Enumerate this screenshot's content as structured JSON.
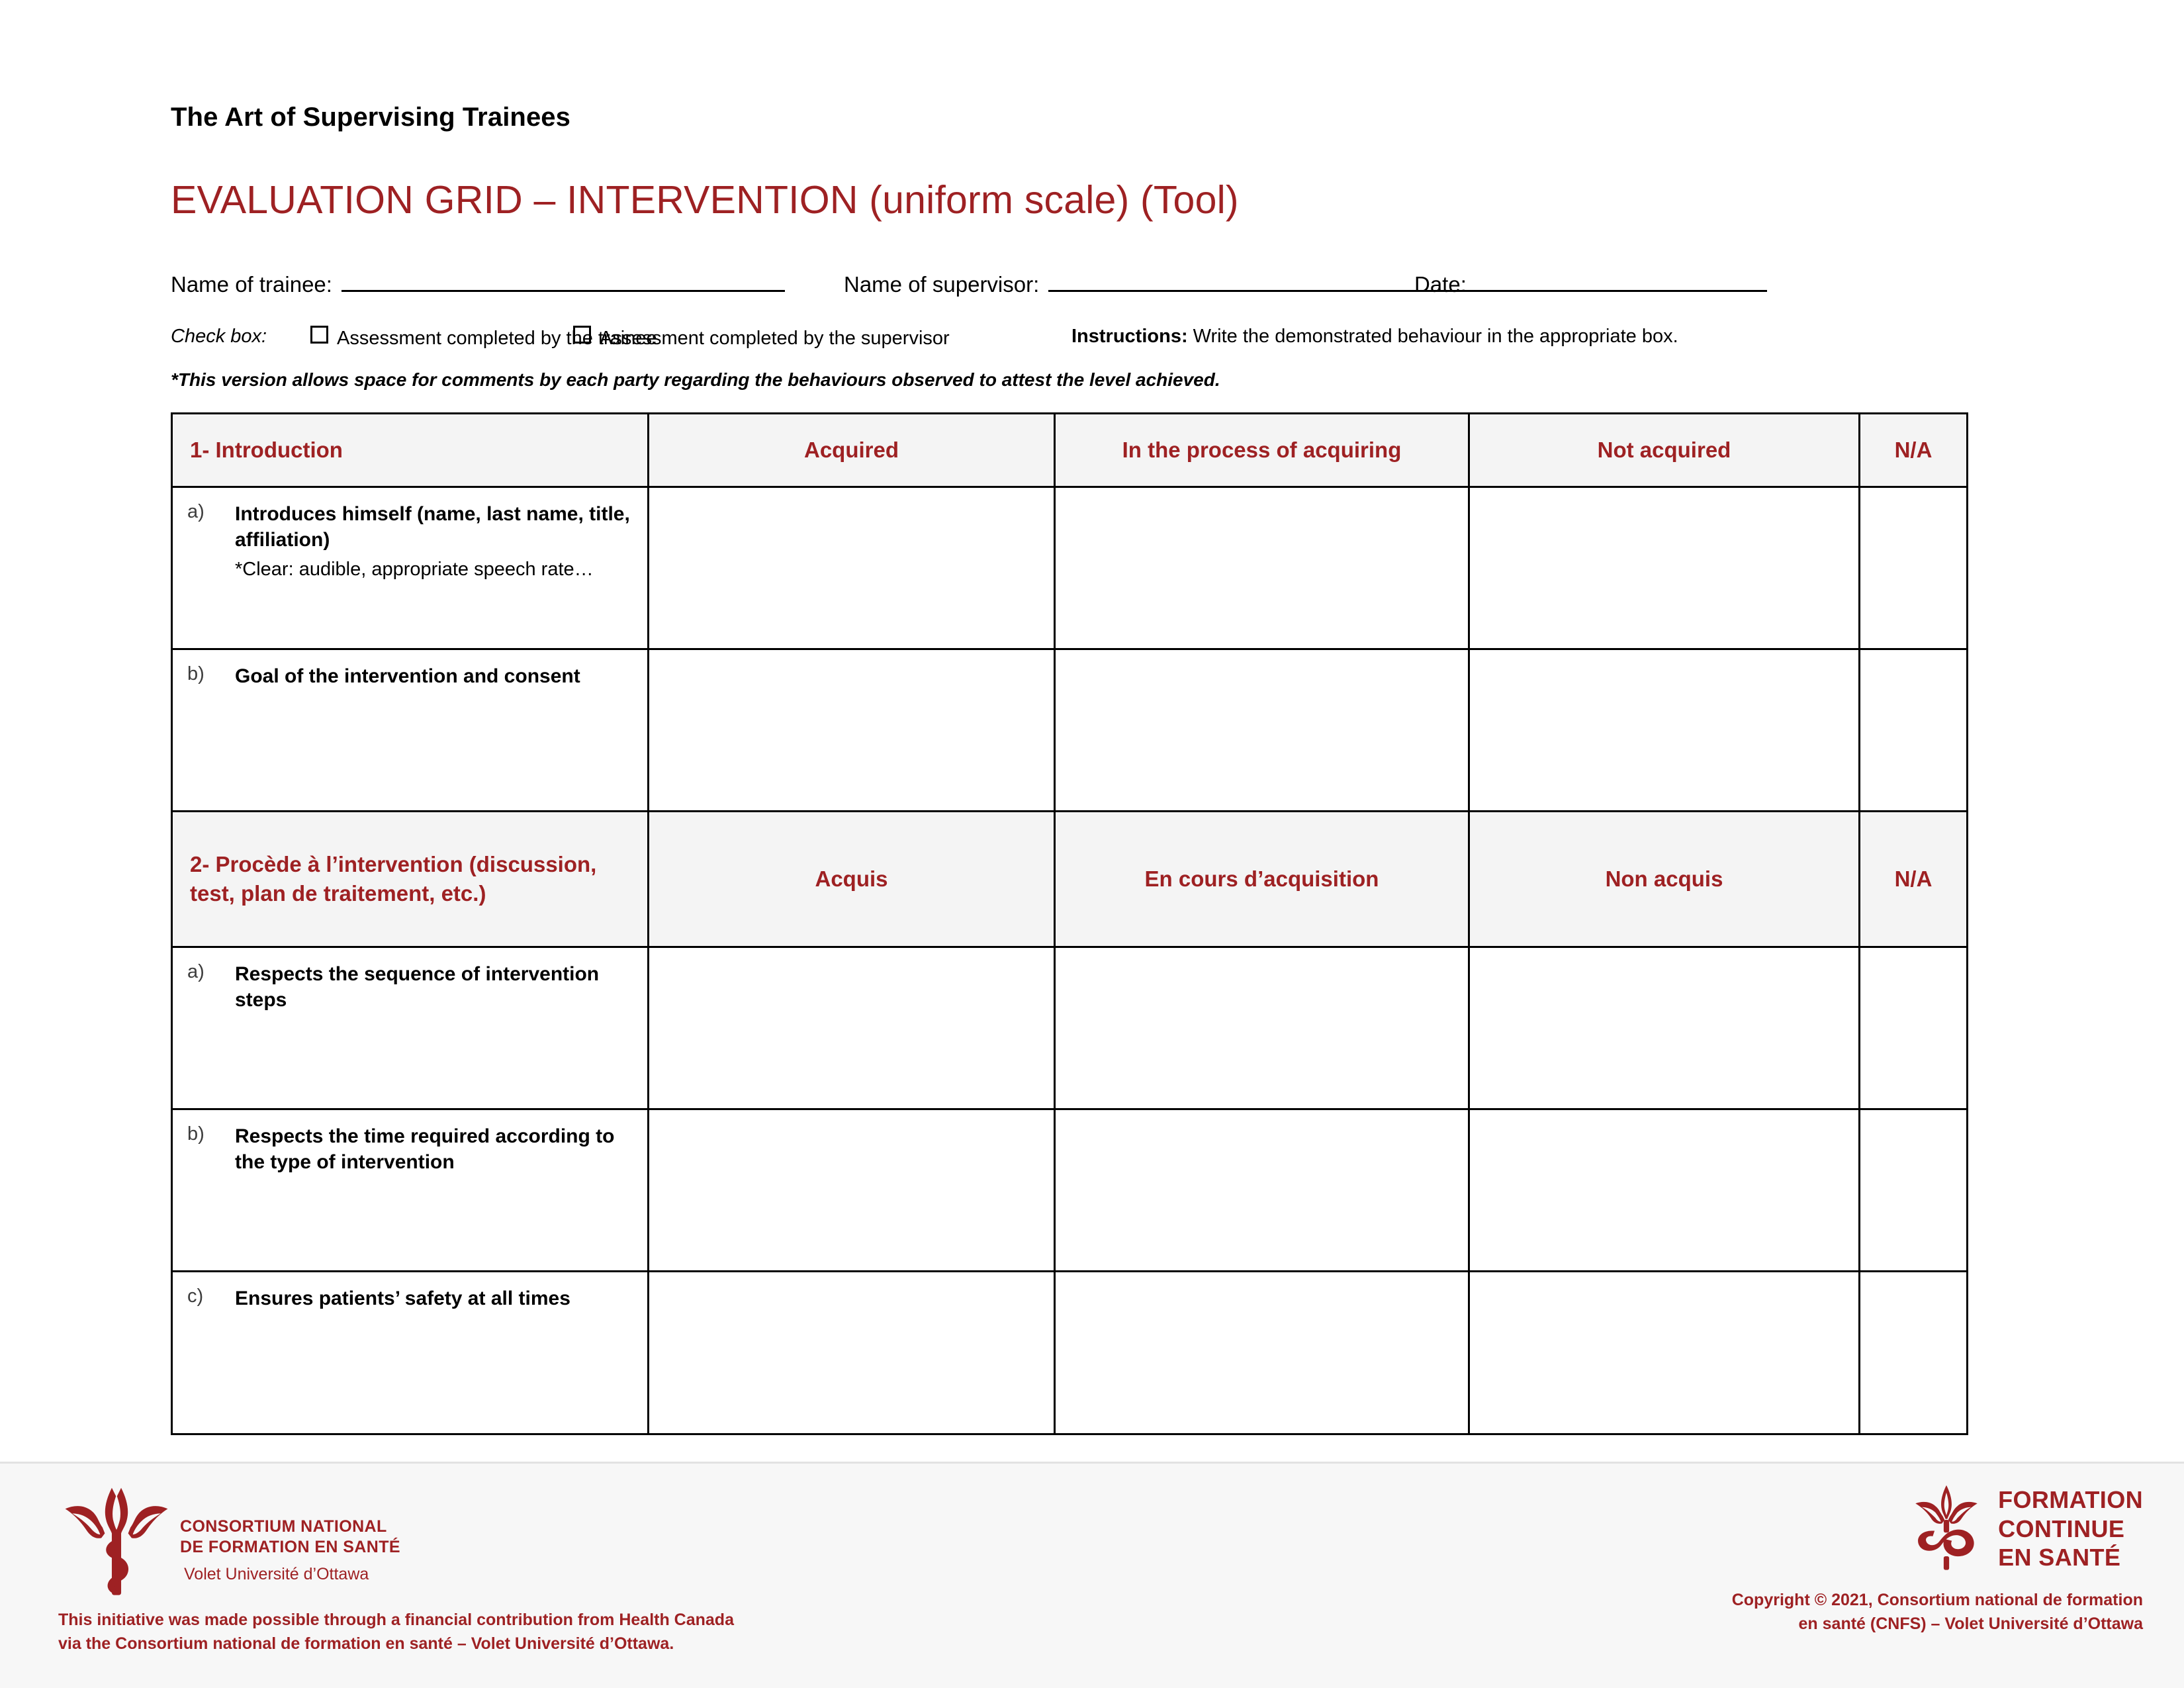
{
  "colors": {
    "accent_red": "#9E2123",
    "header_fill": "#f4f4f4",
    "footer_bg": "#f7f7f7",
    "rule_black": "#000000"
  },
  "header": {
    "kicker": "The Art of Supervising Trainees",
    "title": "EVALUATION GRID – INTERVENTION (uniform scale) (Tool)"
  },
  "identity": {
    "trainee_label": "Name of trainee:",
    "trainee_value": "",
    "supervisor_label": "Name of supervisor:",
    "supervisor_value": "",
    "date_label": "Date:",
    "date_value": ""
  },
  "checkbox_row": {
    "check_box_label": "Check box:",
    "option_trainee": "Assessment completed by the trainee",
    "option_supervisor": "Assessment completed by the supervisor",
    "instructions_label": "Instructions:",
    "instructions_text": " Write the demonstrated behaviour in the appropriate box.",
    "version_note": "*This version allows space for comments by each party regarding the behaviours observed to attest the level achieved."
  },
  "grid": {
    "sections": [
      {
        "title": "1- Introduction",
        "columns": [
          "Acquired",
          "In the process of acquiring",
          "Not acquired",
          "N/A"
        ],
        "items": [
          {
            "letter": "a)",
            "text": "Introduces himself (name, last name, title, affiliation)",
            "subnote": "*Clear: audible, appropriate speech rate…",
            "acquired": "",
            "in_process": "",
            "not_acquired": "",
            "na": ""
          },
          {
            "letter": "b)",
            "text": "Goal of the intervention and consent",
            "subnote": "",
            "acquired": "",
            "in_process": "",
            "not_acquired": "",
            "na": ""
          }
        ]
      },
      {
        "title": "2- Procède à l’intervention (discussion, test, plan de traitement, etc.)",
        "columns": [
          "Acquis",
          "En cours d’acquisition",
          "Non acquis",
          "N/A"
        ],
        "items": [
          {
            "letter": "a)",
            "text": "Respects the sequence of intervention steps",
            "subnote": "",
            "acquired": "",
            "in_process": "",
            "not_acquired": "",
            "na": ""
          },
          {
            "letter": "b)",
            "text": "Respects the time required according to the type of intervention",
            "subnote": "",
            "acquired": "",
            "in_process": "",
            "not_acquired": "",
            "na": ""
          },
          {
            "letter": "c)",
            "text": "Ensures patients’ safety at all times",
            "subnote": "",
            "acquired": "",
            "in_process": "",
            "not_acquired": "",
            "na": ""
          }
        ]
      }
    ]
  },
  "footer": {
    "cnfs_logo_line1": "CONSORTIUM NATIONAL",
    "cnfs_logo_line2": "DE FORMATION EN SANTÉ",
    "cnfs_logo_line3": "Volet Université d’Ottawa",
    "funding_line1": "This initiative was made possible through a financial contribution from Health Canada",
    "funding_line2": "via the Consortium national de formation en santé – Volet Université d’Ottawa.",
    "fc_line1": "FORMATION",
    "fc_line2": "CONTINUE",
    "fc_line3": "EN SANTÉ",
    "copyright_line1": "Copyright © 2021, Consortium national de formation",
    "copyright_line2": "en santé (CNFS) – Volet Université d’Ottawa"
  }
}
